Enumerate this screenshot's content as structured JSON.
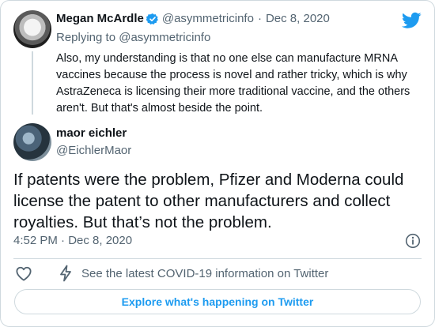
{
  "parent_tweet": {
    "author_name": "Megan McArdle",
    "handle": "@asymmetricinfo",
    "separator": "·",
    "date": "Dec 8, 2020",
    "replying_to": "Replying to @asymmetricinfo",
    "text": "Also, my understanding is that no one else can manufacture MRNA vaccines because the process is novel and rather tricky, which is why AstraZeneca is licensing their more traditional vaccine, and the others aren't. But that's almost beside the point."
  },
  "tweet": {
    "author_name": "maor eichler",
    "handle": "@EichlerMaor",
    "text": "If patents were the problem, Pfizer and Moderna could license the patent to other manufacturers and collect royalties. But that’s not the problem.",
    "timestamp": "4:52 PM · Dec 8, 2020"
  },
  "actions": {
    "covid_info": "See the latest COVID-19 information on Twitter"
  },
  "footer": {
    "explore_label": "Explore what's happening on Twitter"
  },
  "colors": {
    "accent": "#1d9bf0",
    "muted": "#536471",
    "border": "#cfd9de"
  },
  "icons": [
    "twitter-bird-icon",
    "verified-badge-icon",
    "info-icon",
    "heart-icon",
    "lightning-icon"
  ]
}
